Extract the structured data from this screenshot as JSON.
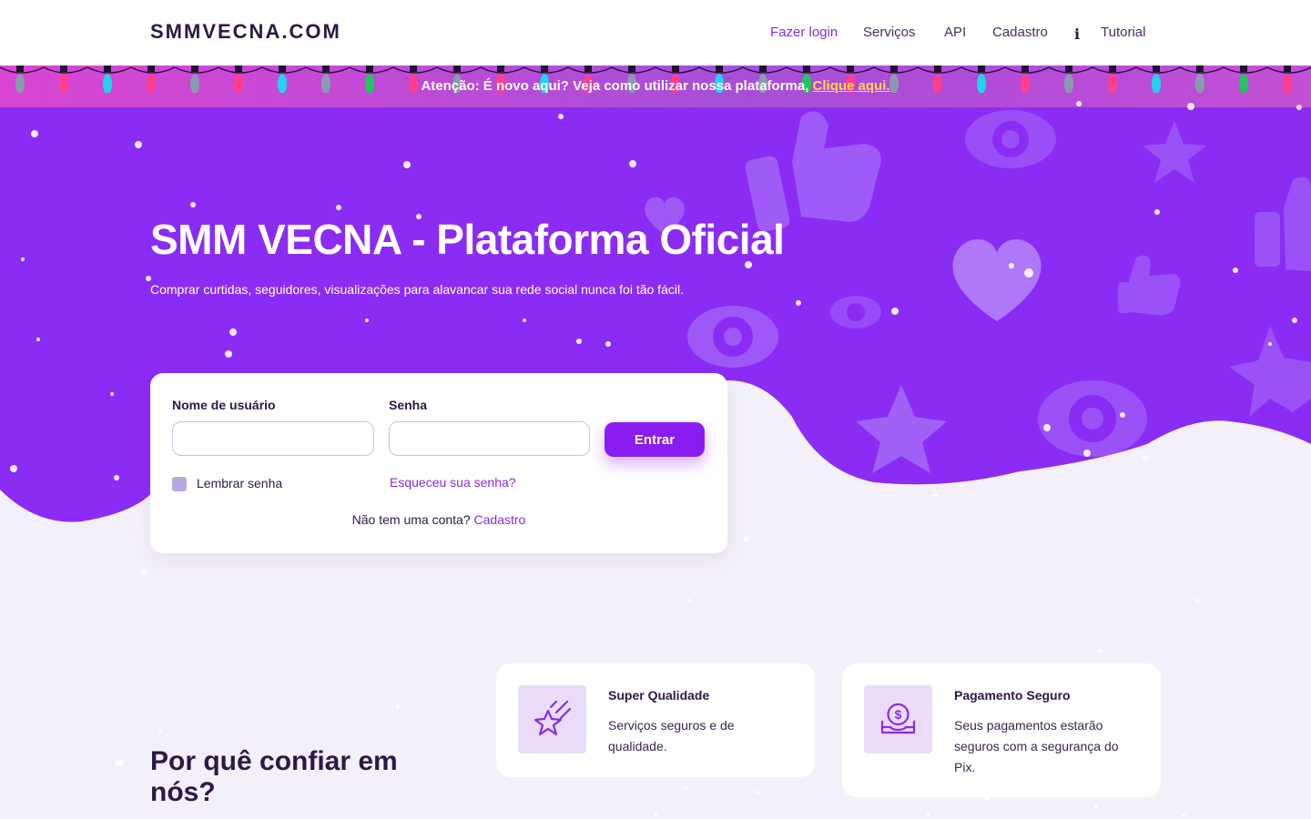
{
  "header": {
    "logo": "SMMVECNA.COM",
    "nav": [
      {
        "label": "Fazer login",
        "active": true
      },
      {
        "label": "Serviços"
      },
      {
        "label": "API"
      },
      {
        "label": "Cadastro"
      },
      {
        "label": "Tutorial",
        "icon": "info-icon"
      }
    ]
  },
  "announcement": {
    "prefix": "Atenção:",
    "text": " É novo aqui? Veja como utilizar nossa plataforma, ",
    "link": "Clique aqui."
  },
  "hero": {
    "title": "SMM VECNA - Plataforma Oficial",
    "subtitle": "Comprar curtidas, seguidores, visualizações para alavancar sua rede social nunca foi tão fácil."
  },
  "login": {
    "username_label": "Nome de usuário",
    "username_value": "",
    "password_label": "Senha",
    "password_value": "",
    "submit_label": "Entrar",
    "remember_label": "Lembrar senha",
    "forgot_link": "Esqueceu sua senha?",
    "signup_prompt": "Não tem uma conta?",
    "signup_link": "Cadastro"
  },
  "why": {
    "title": "Por quê confiar em nós?",
    "features": [
      {
        "icon": "shooting-star-icon",
        "title": "Super Qualidade",
        "text": "Serviços seguros e de qualidade."
      },
      {
        "icon": "money-tray-icon",
        "title": "Pagamento Seguro",
        "text": "Seus pagamentos estarão seguros com a segurança do Pix."
      }
    ]
  },
  "colors": {
    "brand_purple": "#8b2cf5",
    "button": "#8b1cf0",
    "accent_link": "#8a2be2",
    "announce_link": "#ffd54a",
    "page_bg": "#f4f0fa",
    "icon_box_bg": "#eadcf9"
  }
}
